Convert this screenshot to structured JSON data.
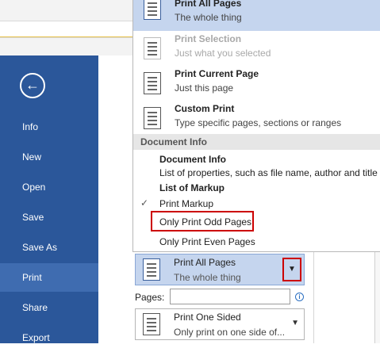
{
  "sidebar": {
    "back_glyph": "←",
    "items": [
      {
        "label": "Info"
      },
      {
        "label": "New"
      },
      {
        "label": "Open"
      },
      {
        "label": "Save"
      },
      {
        "label": "Save As"
      },
      {
        "label": "Print"
      },
      {
        "label": "Share"
      },
      {
        "label": "Export"
      }
    ],
    "active": "Print"
  },
  "menu": {
    "items": [
      {
        "title": "Print All Pages",
        "subtitle": "The whole thing",
        "icon": "document-icon",
        "highlighted": true
      },
      {
        "title": "Print Selection",
        "subtitle": "Just what you selected",
        "icon": "selection-icon",
        "disabled": true
      },
      {
        "title": "Print Current Page",
        "subtitle": "Just this page",
        "icon": "page-icon"
      },
      {
        "title": "Custom Print",
        "subtitle": "Type specific pages, sections or ranges",
        "icon": "custom-print-icon"
      }
    ],
    "section_header": "Document Info",
    "document_info_title": "Document Info",
    "document_info_desc": "List of properties, such as file name, author and title",
    "list_of_markup": "List of Markup",
    "print_markup": "Print Markup",
    "print_markup_checked": true,
    "only_odd": "Only Print Odd Pages",
    "only_even": "Only Print Even Pages"
  },
  "settings": {
    "pages_selector": {
      "title": "Print All Pages",
      "subtitle": "The whole thing"
    },
    "pages_label": "Pages:",
    "pages_value": "",
    "sides_selector": {
      "title": "Print One Sided",
      "subtitle": "Only print on one side of..."
    }
  },
  "colors": {
    "sidebar": "#2b579a",
    "sidebar_active": "#3f6cb0",
    "highlight": "#c5d5ee",
    "callout": "#cc0000"
  }
}
